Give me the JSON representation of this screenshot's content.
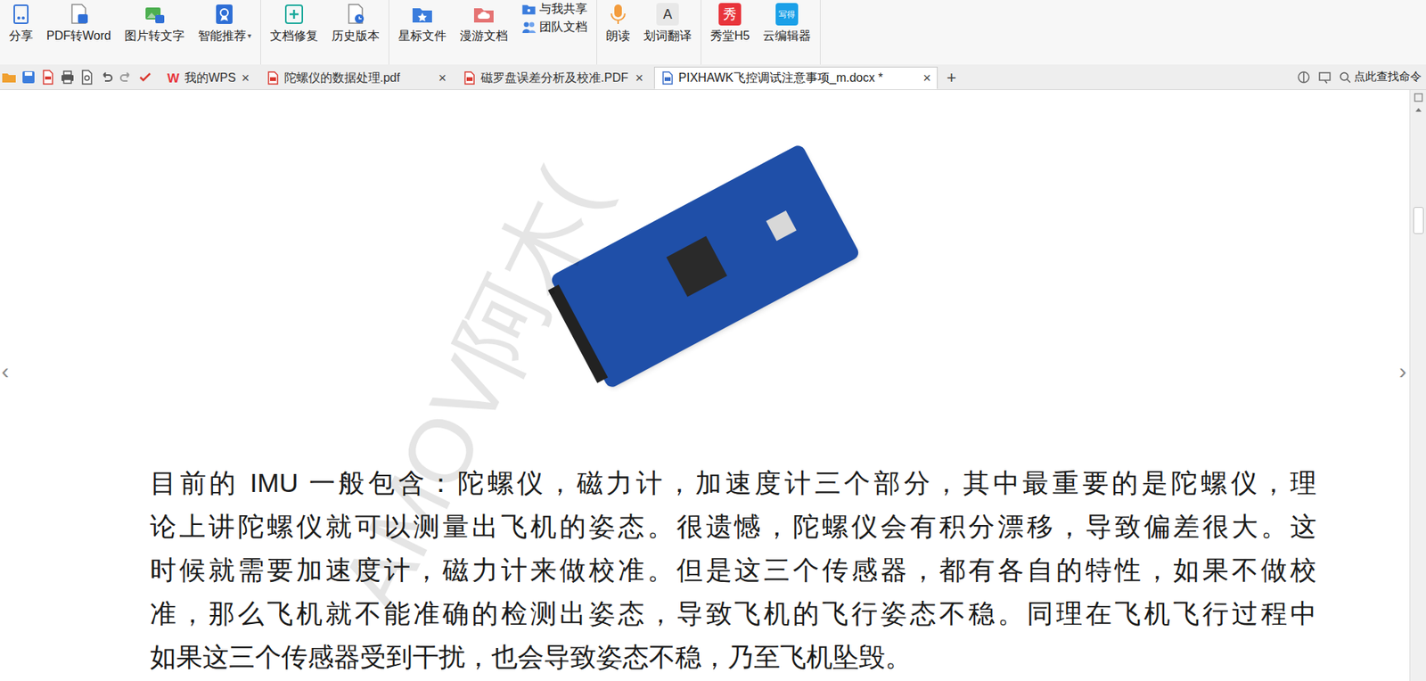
{
  "toolbar": {
    "groups": [
      [
        {
          "label": "分享",
          "kind": "share"
        },
        {
          "label": "PDF转Word",
          "kind": "pdf2word"
        },
        {
          "label": "图片转文字",
          "kind": "img2text"
        },
        {
          "label": "智能推荐",
          "kind": "recommend",
          "caret": "▾"
        }
      ],
      [
        {
          "label": "文档修复",
          "kind": "repair"
        },
        {
          "label": "历史版本",
          "kind": "history"
        }
      ],
      [
        {
          "label": "星标文件",
          "kind": "star"
        },
        {
          "label": "漫游文档",
          "kind": "roam"
        },
        {
          "kind": "stack",
          "items": [
            {
              "label": "与我共享",
              "kind": "share-with-me"
            },
            {
              "label": "团队文档",
              "kind": "team"
            }
          ]
        }
      ],
      [
        {
          "label": "朗读",
          "kind": "read"
        },
        {
          "label": "划词翻译",
          "kind": "translate",
          "icon_text": "A"
        }
      ],
      [
        {
          "label": "秀堂H5",
          "kind": "xiutang",
          "icon_text": "秀"
        },
        {
          "label": "云编辑器",
          "kind": "cloud-editor",
          "icon_text": "写得"
        }
      ]
    ]
  },
  "tabs": [
    {
      "label": "我的WPS",
      "kind": "wps",
      "icon_text": "W",
      "close": "×",
      "selected": false
    },
    {
      "label": "陀螺仪的数据处理.pdf",
      "kind": "pdf",
      "close": "×",
      "selected": false
    },
    {
      "label": "磁罗盘误差分析及校准.PDF",
      "kind": "pdf",
      "close": "×",
      "selected": false
    },
    {
      "label": "PIXHAWK飞控调试注意事项_m.docx *",
      "kind": "doc",
      "close": "×",
      "selected": true
    }
  ],
  "new_tab": "+",
  "command_search": {
    "label": "点此查找命令"
  },
  "document": {
    "watermark": "AMOV阿木(",
    "prev": "‹",
    "next": "›",
    "lines": [
      "目前的 IMU 一般包含：陀螺仪，磁力计，加速度计三个部分，其中最重要的是陀螺仪，理",
      "论上讲陀螺仪就可以测量出飞机的姿态。很遗憾，陀螺仪会有积分漂移，导致偏差很大。这",
      "时候就需要加速度计，磁力计来做校准。但是这三个传感器，都有各自的特性，如果不做校",
      "准，那么飞机就不能准确的检测出姿态，导致飞机的飞行姿态不稳。同理在飞机飞行过程中",
      "如果这三个传感器受到干扰，也会导致姿态不稳，乃至飞机坠毁。"
    ]
  }
}
